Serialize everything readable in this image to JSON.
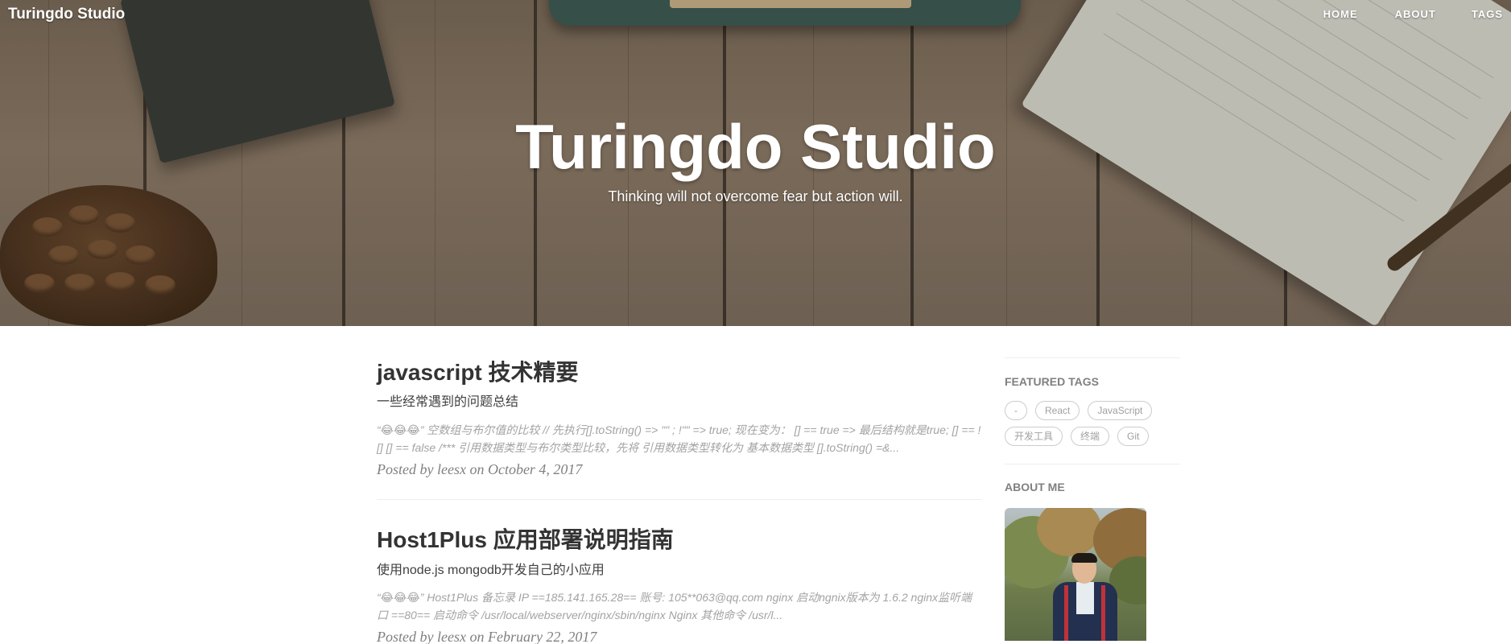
{
  "navbar": {
    "brand": "Turingdo Studio",
    "items": [
      "HOME",
      "ABOUT",
      "TAGS"
    ]
  },
  "hero": {
    "title": "Turingdo Studio",
    "subtitle": "Thinking will not overcome fear but action will."
  },
  "posts": [
    {
      "title": "javascript 技术精要",
      "subtitle": "一些经常遇到的问题总结",
      "excerpt_line1": "“😂😂😂” 空数组与布尔值的比较 // 先执行[].toString() => \"\" ; !\"\" => true; 现在变为： [] == true => 最后结构就是true; [] == !",
      "excerpt_line2": "[] [] == false /*** 引用数据类型与布尔类型比较，先将 引用数据类型转化为 基本数据类型 [].toString() =&...",
      "meta": "Posted by leesx on October 4, 2017"
    },
    {
      "title": "Host1Plus 应用部署说明指南",
      "subtitle": "使用node.js mongodb开发自己的小应用",
      "excerpt_line1": "“😂😂😂” Host1Plus 备忘录 IP ==185.141.165.28== 账号: 105**063@qq.com nginx 启动ngnix版本为 1.6.2 nginx监听端",
      "excerpt_line2": "口 ==80== 启动命令 /usr/local/webserver/nginx/sbin/nginx Nginx 其他命令 /usr/l...",
      "meta": "Posted by leesx on February 22, 2017"
    }
  ],
  "sidebar": {
    "featured_heading": "FEATURED TAGS",
    "tags": [
      "-",
      "React",
      "JavaScript",
      "开发工具",
      "终端",
      "Git"
    ],
    "about_heading": "ABOUT ME"
  },
  "colors": {
    "hero_wood": "#8b7966",
    "text_dark": "#333333",
    "text_muted": "#a3a3a3",
    "tag_border": "#cccccc"
  }
}
